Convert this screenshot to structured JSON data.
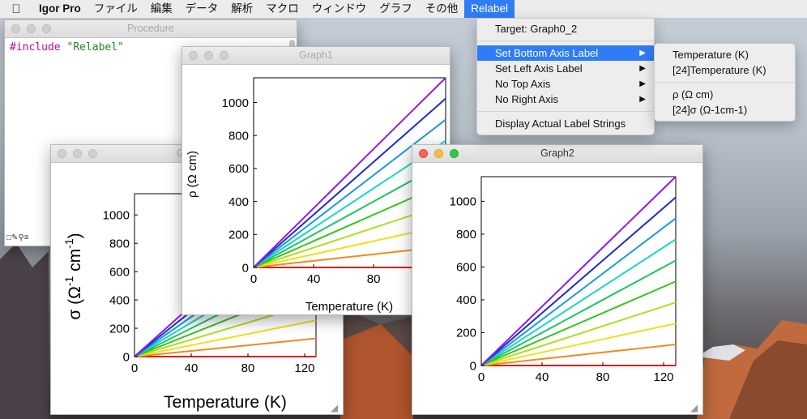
{
  "menubar": {
    "apple": "",
    "app": "Igor Pro",
    "items": [
      "ファイル",
      "編集",
      "データ",
      "解析",
      "マクロ",
      "ウィンドウ",
      "グラフ",
      "その他",
      "Relabel"
    ]
  },
  "procedure": {
    "title": "Procedure",
    "code_keyword": "#include",
    "code_string": "\"Relabel\""
  },
  "graph_back": {
    "title_fragment": "G"
  },
  "graph1": {
    "title": "Graph1"
  },
  "graph2": {
    "title": "Graph2"
  },
  "relabel_menu": {
    "target": "Target: Graph0_2",
    "set_bottom": "Set Bottom Axis Label",
    "set_left": "Set Left Axis Label",
    "no_top": "No Top Axis",
    "no_right": "No Right Axis",
    "display": "Display Actual Label Strings"
  },
  "submenu": {
    "opt1": "Temperature (K)",
    "opt2": "[24]Temperature (K)",
    "opt3": "ρ (Ω cm)",
    "opt4": "[24]σ (Ω-1cm-1)"
  },
  "chart_data": [
    {
      "type": "line",
      "name": "Graph (back)",
      "x_ticks": [
        0,
        40,
        80,
        120
      ],
      "y_ticks": [
        0,
        200,
        400,
        600,
        800,
        1000
      ],
      "xlim": [
        0,
        128
      ],
      "ylim": [
        0,
        1150
      ],
      "xlabel": "Temperature (K)",
      "ylabel_parts": [
        "σ (Ω",
        "-1",
        " cm",
        "-1",
        ")"
      ],
      "series": [
        {
          "color": "#e8120c",
          "values": [
            [
              0,
              0
            ],
            [
              128,
              0
            ]
          ]
        },
        {
          "color": "#f08a1c",
          "values": [
            [
              0,
              0
            ],
            [
              128,
              128
            ]
          ]
        },
        {
          "color": "#f0e01a",
          "values": [
            [
              0,
              0
            ],
            [
              128,
              256
            ]
          ]
        },
        {
          "color": "#aee01a",
          "values": [
            [
              0,
              0
            ],
            [
              128,
              384
            ]
          ]
        },
        {
          "color": "#35c51c",
          "values": [
            [
              0,
              0
            ],
            [
              128,
              512
            ]
          ]
        },
        {
          "color": "#1cc55f",
          "values": [
            [
              0,
              0
            ],
            [
              128,
              640
            ]
          ]
        },
        {
          "color": "#1ad6c8",
          "values": [
            [
              0,
              0
            ],
            [
              128,
              768
            ]
          ]
        },
        {
          "color": "#1c98e8",
          "values": [
            [
              0,
              0
            ],
            [
              128,
              896
            ]
          ]
        },
        {
          "color": "#1c2ad0",
          "values": [
            [
              0,
              0
            ],
            [
              128,
              1024
            ]
          ]
        },
        {
          "color": "#8c1ce8",
          "values": [
            [
              0,
              0
            ],
            [
              128,
              1152
            ]
          ]
        }
      ]
    },
    {
      "type": "line",
      "name": "Graph1",
      "x_ticks": [
        0,
        40,
        80
      ],
      "y_ticks": [
        0,
        200,
        400,
        600,
        800,
        1000
      ],
      "xlim": [
        0,
        128
      ],
      "ylim": [
        0,
        1150
      ],
      "xlabel": "Temperature (K)",
      "ylabel": "ρ (Ω cm)",
      "series": [
        {
          "color": "#e8120c",
          "values": [
            [
              0,
              0
            ],
            [
              128,
              0
            ]
          ]
        },
        {
          "color": "#f08a1c",
          "values": [
            [
              0,
              0
            ],
            [
              128,
              128
            ]
          ]
        },
        {
          "color": "#f0e01a",
          "values": [
            [
              0,
              0
            ],
            [
              128,
              256
            ]
          ]
        },
        {
          "color": "#aee01a",
          "values": [
            [
              0,
              0
            ],
            [
              128,
              384
            ]
          ]
        },
        {
          "color": "#35c51c",
          "values": [
            [
              0,
              0
            ],
            [
              128,
              512
            ]
          ]
        },
        {
          "color": "#1cc55f",
          "values": [
            [
              0,
              0
            ],
            [
              128,
              640
            ]
          ]
        },
        {
          "color": "#1ad6c8",
          "values": [
            [
              0,
              0
            ],
            [
              128,
              768
            ]
          ]
        },
        {
          "color": "#1c98e8",
          "values": [
            [
              0,
              0
            ],
            [
              128,
              896
            ]
          ]
        },
        {
          "color": "#1c2ad0",
          "values": [
            [
              0,
              0
            ],
            [
              128,
              1024
            ]
          ]
        },
        {
          "color": "#8c1ce8",
          "values": [
            [
              0,
              0
            ],
            [
              128,
              1152
            ]
          ]
        }
      ]
    },
    {
      "type": "line",
      "name": "Graph2",
      "x_ticks": [
        0,
        40,
        80,
        120
      ],
      "y_ticks": [
        0,
        200,
        400,
        600,
        800,
        1000
      ],
      "xlim": [
        0,
        128
      ],
      "ylim": [
        0,
        1150
      ],
      "xlabel": "",
      "ylabel": "",
      "series": [
        {
          "color": "#e8120c",
          "values": [
            [
              0,
              0
            ],
            [
              128,
              0
            ]
          ]
        },
        {
          "color": "#f08a1c",
          "values": [
            [
              0,
              0
            ],
            [
              128,
              128
            ]
          ]
        },
        {
          "color": "#f0e01a",
          "values": [
            [
              0,
              0
            ],
            [
              128,
              256
            ]
          ]
        },
        {
          "color": "#aee01a",
          "values": [
            [
              0,
              0
            ],
            [
              128,
              384
            ]
          ]
        },
        {
          "color": "#35c51c",
          "values": [
            [
              0,
              0
            ],
            [
              128,
              512
            ]
          ]
        },
        {
          "color": "#1cc55f",
          "values": [
            [
              0,
              0
            ],
            [
              128,
              640
            ]
          ]
        },
        {
          "color": "#1ad6c8",
          "values": [
            [
              0,
              0
            ],
            [
              128,
              768
            ]
          ]
        },
        {
          "color": "#1c98e8",
          "values": [
            [
              0,
              0
            ],
            [
              128,
              896
            ]
          ]
        },
        {
          "color": "#1c2ad0",
          "values": [
            [
              0,
              0
            ],
            [
              128,
              1024
            ]
          ]
        },
        {
          "color": "#8c1ce8",
          "values": [
            [
              0,
              0
            ],
            [
              128,
              1152
            ]
          ]
        }
      ]
    }
  ]
}
